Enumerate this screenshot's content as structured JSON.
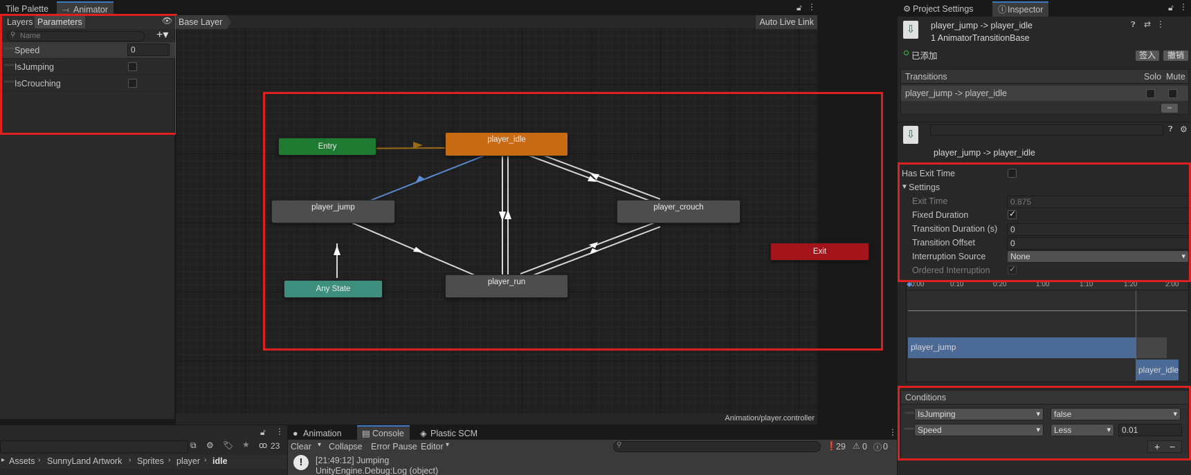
{
  "tabs_left": {
    "tile_palette": "Tile Palette",
    "animator": "Animator"
  },
  "animator": {
    "side_tabs": {
      "layers": "Layers",
      "parameters": "Parameters"
    },
    "search_placeholder": "Name",
    "breadcrumb": "Base Layer",
    "auto_live_link": "Auto Live Link",
    "footer_path": "Animation/player.controller",
    "parameters": [
      {
        "name": "Speed",
        "value": "0",
        "type": "float"
      },
      {
        "name": "IsJumping",
        "type": "bool",
        "checked": false
      },
      {
        "name": "IsCrouching",
        "type": "bool",
        "checked": false
      }
    ],
    "nodes": {
      "entry": "Entry",
      "idle": "player_idle",
      "jump": "player_jump",
      "crouch": "player_crouch",
      "run": "player_run",
      "any_state": "Any State",
      "exit": "Exit"
    },
    "colors": {
      "entry": "#1e7a30",
      "idle": "#c96b14",
      "default": "#4d4d4d",
      "any_state": "#3f8f7e",
      "exit": "#a5141b"
    }
  },
  "tabs_right": {
    "project_settings": "Project Settings",
    "inspector": "Inspector"
  },
  "inspector": {
    "title": "player_jump -> player_idle",
    "subtitle": "1 AnimatorTransitionBase",
    "status": "已添加",
    "checkin_button": "签入",
    "undo_button": "撤销",
    "transitions_header": "Transitions",
    "solo": "Solo",
    "mute": "Mute",
    "transition_row": "player_jump -> player_idle",
    "transition_name": "player_jump -> player_idle",
    "has_exit_time": "Has Exit Time",
    "settings": "Settings",
    "exit_time_label": "Exit Time",
    "exit_time_value": "0.875",
    "fixed_duration": "Fixed Duration",
    "transition_duration_label": "Transition Duration (s)",
    "transition_duration_value": "0",
    "transition_offset_label": "Transition Offset",
    "transition_offset_value": "0",
    "interruption_source_label": "Interruption Source",
    "interruption_source_value": "None",
    "ordered_interruption": "Ordered Interruption",
    "timeline_ticks": [
      "0:00",
      "0:10",
      "0:20",
      "1:00",
      "1:10",
      "1:20",
      "2:00"
    ],
    "timeline_src": "player_jump",
    "timeline_dst": "player_idle",
    "conditions_header": "Conditions",
    "conditions": [
      {
        "param": "IsJumping",
        "op": "false",
        "value": ""
      },
      {
        "param": "Speed",
        "op": "Less",
        "value": "0.01"
      }
    ]
  },
  "bottom": {
    "count_hidden": "23",
    "breadcrumb": [
      "Assets",
      "SunnyLand Artwork",
      "Sprites",
      "player",
      "idle"
    ],
    "tabs": {
      "animation": "Animation",
      "console": "Console",
      "plastic": "Plastic SCM"
    },
    "toolbar": {
      "clear": "Clear",
      "collapse": "Collapse",
      "error_pause": "Error Pause",
      "editor": "Editor"
    },
    "counts": {
      "info": "29",
      "warn": "0",
      "error": "0"
    },
    "log": {
      "line1": "[21:49:12] Jumping",
      "line2": "UnityEngine.Debug:Log (object)"
    }
  }
}
